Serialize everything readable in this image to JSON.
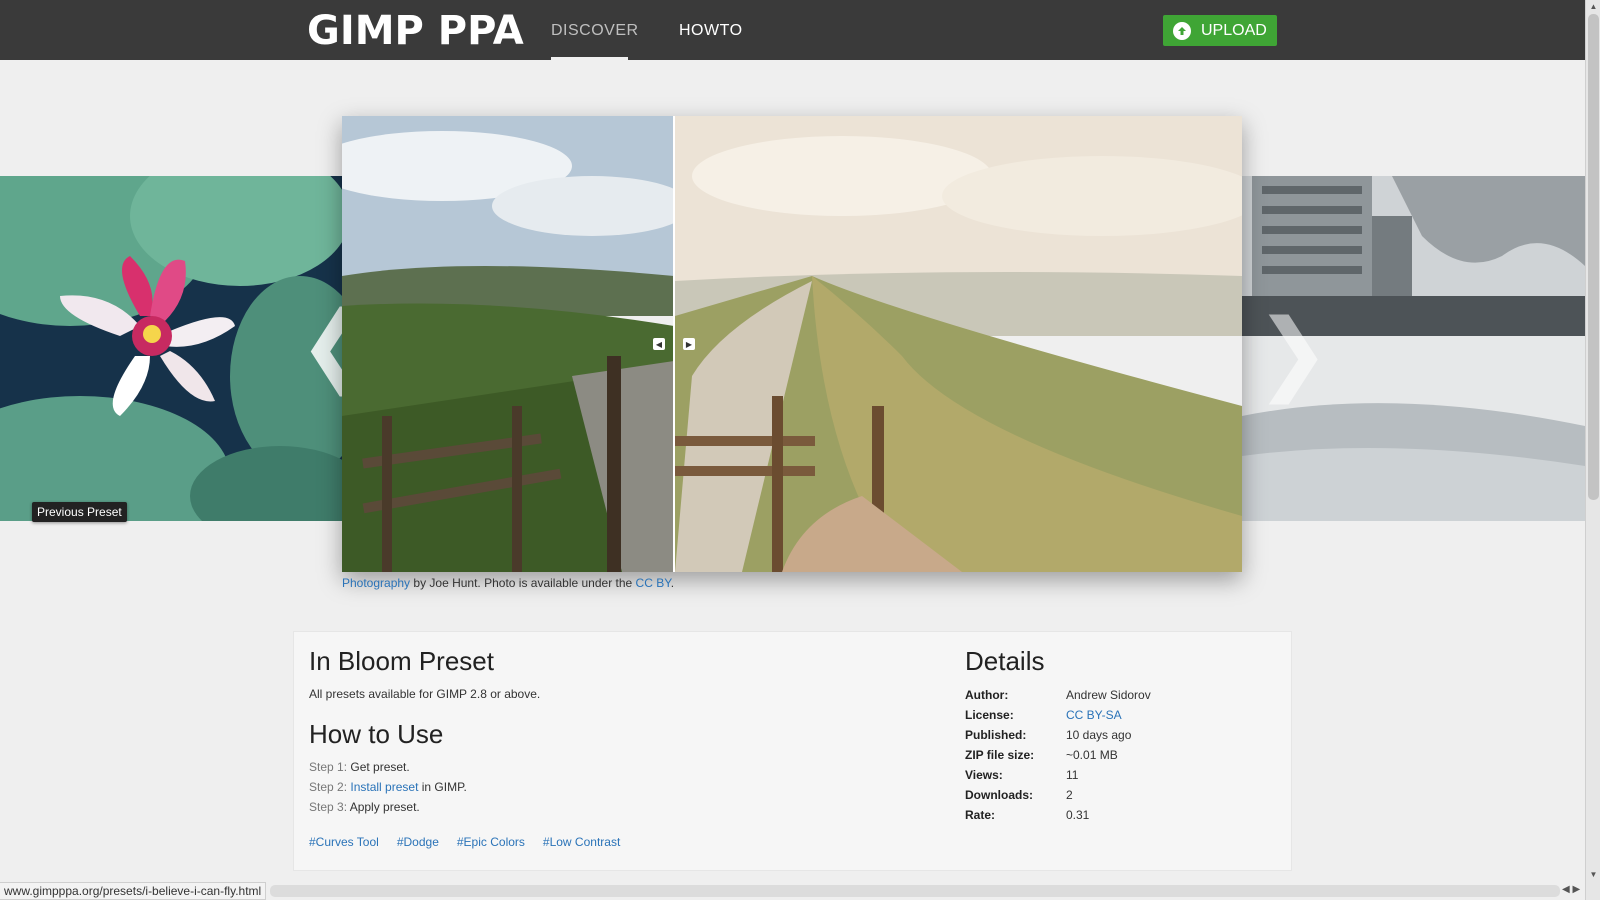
{
  "header": {
    "logo": "GIMP PPA",
    "nav": [
      {
        "label": "DISCOVER",
        "active": true
      },
      {
        "label": "HOWTO",
        "active": false
      }
    ],
    "upload_label": "UPLOAD",
    "background_color": "#3a3a3a",
    "upload_color": "#3fa535"
  },
  "carousel": {
    "prev_arrow": "❮",
    "next_arrow": "❯",
    "tooltip": "Previous Preset"
  },
  "caption": {
    "link1": "Photography",
    "middle": " by Joe Hunt. Photo is available under the ",
    "link2": "CC BY",
    "end": "."
  },
  "preset": {
    "title": "In Bloom Preset",
    "subtitle": "All presets available for GIMP 2.8 or above.",
    "howto_title": "How to Use",
    "steps": [
      {
        "label": "Step 1:",
        "text": " Get preset.",
        "link": "",
        "after": ""
      },
      {
        "label": "Step 2:",
        "text": " ",
        "link": "Install preset",
        "after": " in GIMP."
      },
      {
        "label": "Step 3:",
        "text": " Apply preset.",
        "link": "",
        "after": ""
      }
    ],
    "tags": [
      "#Curves Tool",
      "#Dodge",
      "#Epic Colors",
      "#Low Contrast"
    ]
  },
  "details": {
    "title": "Details",
    "rows": [
      {
        "key": "Author:",
        "value": "Andrew Sidorov"
      },
      {
        "key": "License:",
        "value": "CC BY-SA"
      },
      {
        "key": "Published:",
        "value": "10 days ago"
      },
      {
        "key": "ZIP file size:",
        "value": "~0.01 MB"
      },
      {
        "key": "Views:",
        "value": "11"
      },
      {
        "key": "Downloads:",
        "value": "2"
      },
      {
        "key": "Rate:",
        "value": "0.31"
      }
    ]
  },
  "statusbar": {
    "url": "www.gimpppa.org/presets/i-believe-i-can-fly.html"
  },
  "colors": {
    "link": "#2a73b8",
    "page_bg": "#efefef"
  }
}
